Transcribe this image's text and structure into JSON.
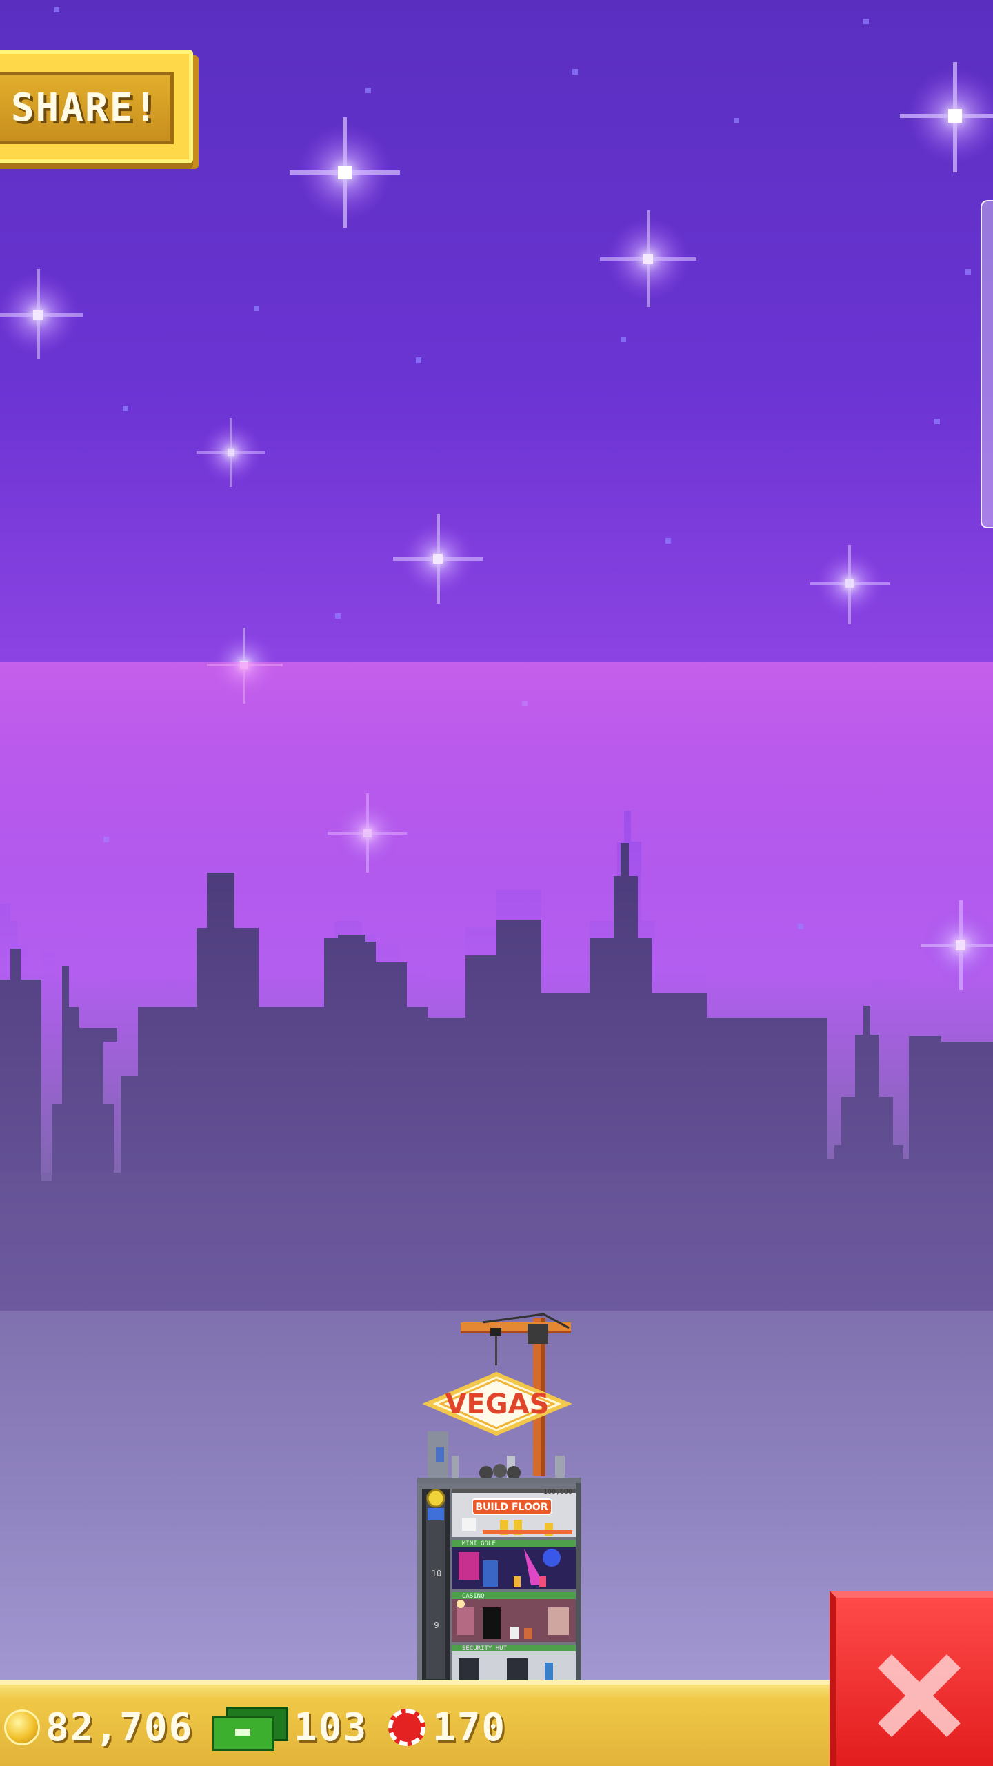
{
  "buttons": {
    "share_label": "SHARE!"
  },
  "tower": {
    "sign_label": "VEGAS",
    "build_floor_label": "BUILD FLOOR",
    "top_value_label": "100,000",
    "floor_labels": [
      "MINI GOLF",
      "CASINO",
      "SECURITY HUT"
    ],
    "floor_numbers": [
      "10",
      "9"
    ]
  },
  "currency": {
    "coins": "82,706",
    "bux": "103",
    "chips": "170"
  },
  "icons": {
    "coin": "coin-icon",
    "bux": "tower-bux-icon",
    "chip": "casino-chip-icon",
    "close": "close-x-icon",
    "elevator": "elevator-icon",
    "crane": "crane-icon"
  },
  "colors": {
    "sky_top": "#5a2fc0",
    "sky_mid": "#8e43e6",
    "skyline": "#4c3a78",
    "ground_haze": "#b6aae6",
    "bottom_bar": "#e8b93c",
    "close_button": "#f02626",
    "share_button": "#f5c535"
  }
}
